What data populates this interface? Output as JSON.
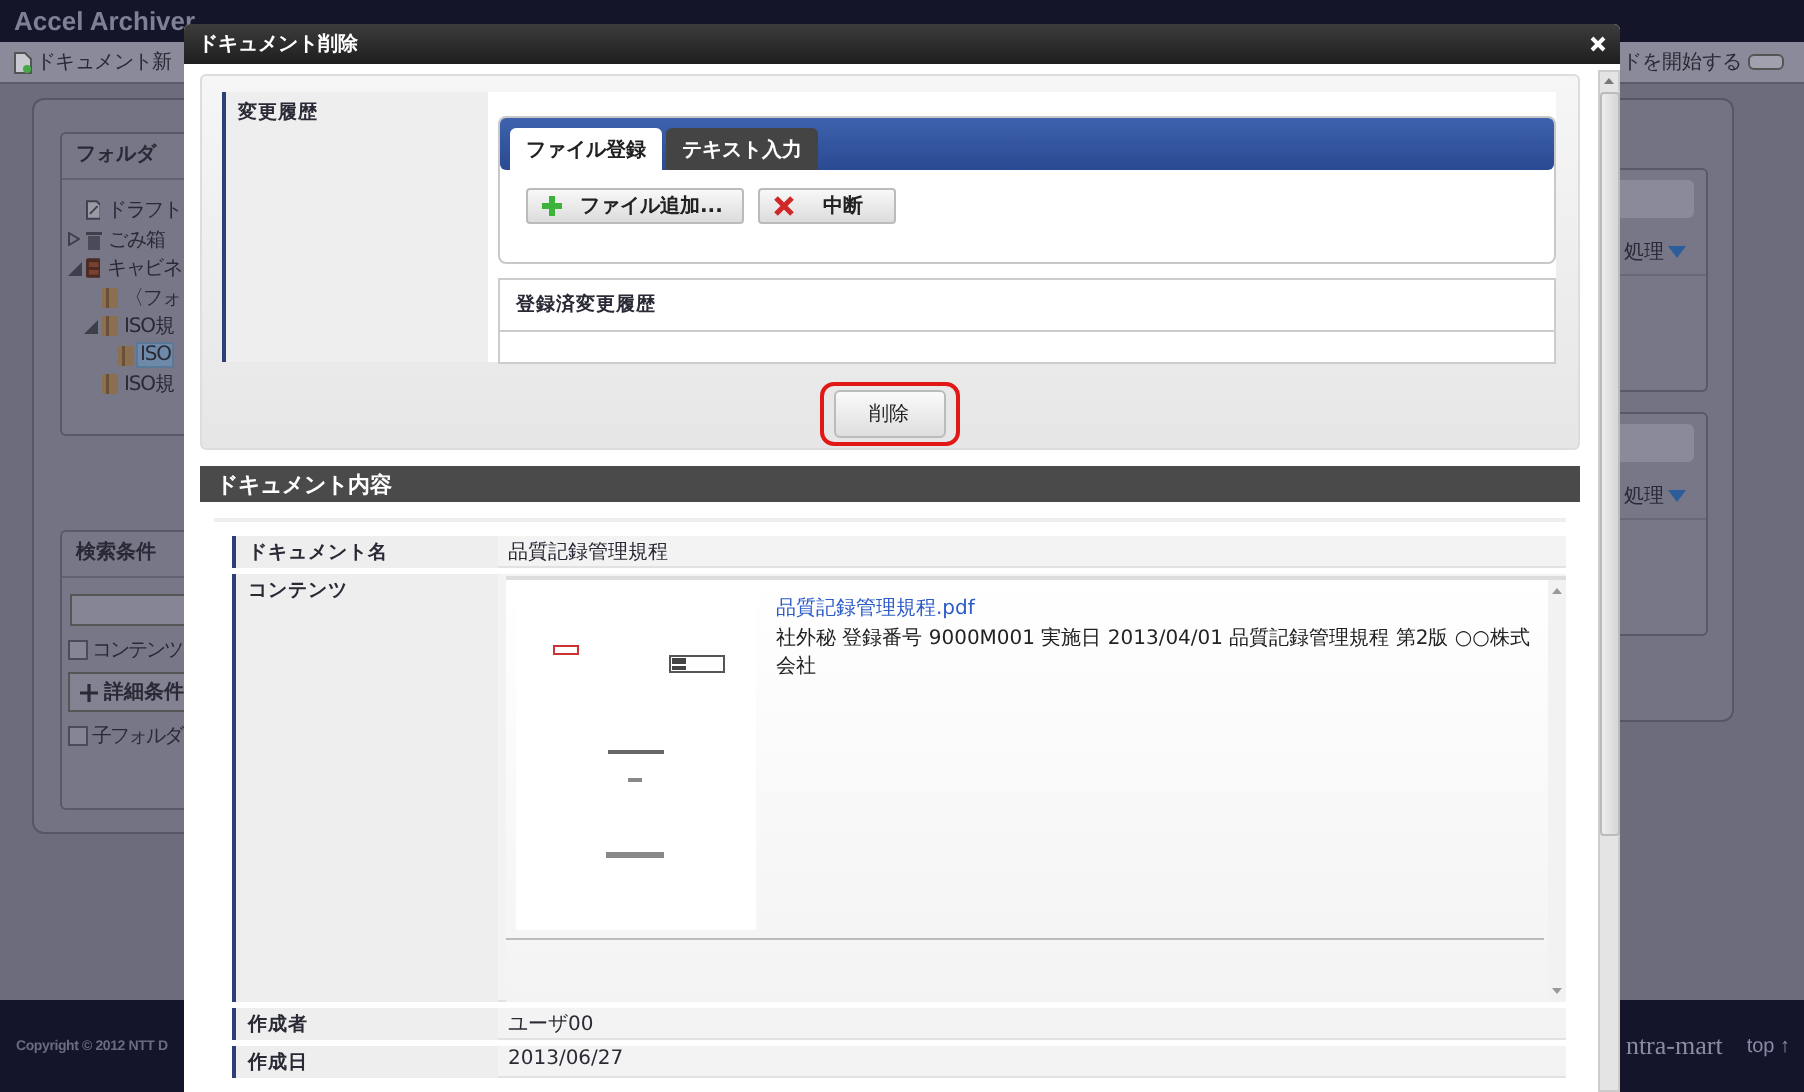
{
  "app": {
    "title": "Accel Archiver",
    "toolbar_left": "ドキュメント新",
    "toolbar_right": "ドを開始する",
    "toggle_on": false
  },
  "folder_panel": {
    "title": "フォルダ",
    "tree": [
      {
        "label": "ドラフト",
        "kind": "draft",
        "selected": false
      },
      {
        "label": "ごみ箱",
        "kind": "trash",
        "expanded": false,
        "selected": false
      },
      {
        "label": "キャビネ",
        "kind": "cabinet",
        "expanded": true,
        "selected": false,
        "children": [
          {
            "label": "〈フォ",
            "kind": "folder",
            "selected": false
          },
          {
            "label": "ISO規",
            "kind": "folder",
            "expanded": true,
            "selected": false,
            "children": [
              {
                "label": "ISO",
                "kind": "folder",
                "selected": true
              }
            ]
          },
          {
            "label": "ISO規",
            "kind": "folder",
            "selected": false
          }
        ]
      }
    ]
  },
  "search_panel": {
    "title": "検索条件",
    "checkboxes": [
      {
        "label": "コンテンツ",
        "checked": false
      },
      {
        "label": "子フォルダ",
        "checked": false
      }
    ],
    "detail_button": "詳細条件"
  },
  "right_panels": [
    {
      "action": "処理"
    },
    {
      "action": "処理"
    }
  ],
  "footer": {
    "copyright": "Copyright © 2012 NTT D",
    "brand": "ntra-mart",
    "top_link": "top ↑"
  },
  "dialog": {
    "title": "ドキュメント削除",
    "history": {
      "label": "変更履歴",
      "tabs": [
        {
          "label": "ファイル登録",
          "selected": true
        },
        {
          "label": "テキスト入力",
          "selected": false
        }
      ],
      "buttons": [
        {
          "label": "ファイル追加...",
          "kind": "add"
        },
        {
          "label": "中断",
          "kind": "cancel"
        }
      ],
      "table_header": "登録済変更履歴"
    },
    "delete_button": "削除",
    "content": {
      "title": "ドキュメント内容",
      "fields": [
        {
          "label": "ドキュメント名",
          "kind": "text",
          "value": "品質記録管理規程"
        },
        {
          "label": "コンテンツ",
          "kind": "file",
          "file_name": "品質記録管理規程.pdf",
          "description": "社外秘 登録番号 9000M001 実施日 2013/04/01 品質記録管理規程 第2版 ○○株式会社"
        },
        {
          "label": "作成者",
          "kind": "text",
          "value": "ユーザ00"
        },
        {
          "label": "作成日",
          "kind": "text",
          "value": "2013/06/27"
        }
      ]
    }
  }
}
